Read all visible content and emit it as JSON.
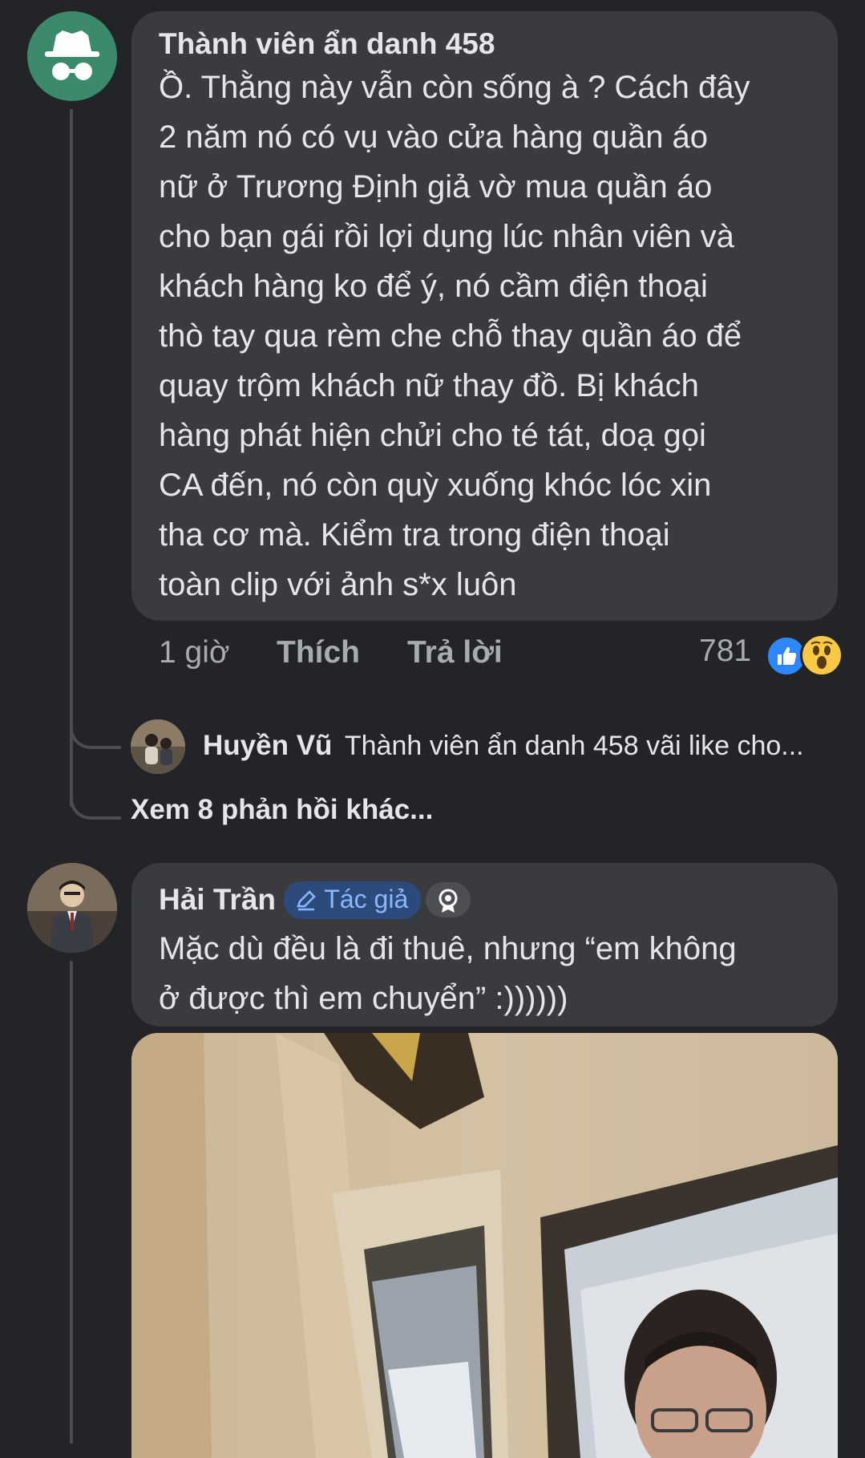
{
  "comment1": {
    "author": "Thành viên ẩn danh 458",
    "lines": [
      "Ồ. Thằng này vẫn còn sống à ? Cách đây",
      "2 năm nó có vụ vào cửa hàng quần áo",
      "nữ ở Trương Định giả vờ mua quần áo",
      "cho bạn gái rồi lợi dụng lúc nhân viên và",
      "khách hàng ko để ý, nó cầm điện thoại",
      "thò tay qua rèm che chỗ thay quần áo để",
      "quay trộm khách nữ thay đồ. Bị khách",
      "hàng phát hiện chửi cho té tát, doạ gọi",
      "CA đến, nó còn quỳ xuống khóc lóc xin",
      "tha cơ mà. Kiểm tra trong điện thoại",
      "toàn clip với ảnh s*x luôn"
    ],
    "time": "1 giờ",
    "like_label": "Thích",
    "reply_label": "Trả lời",
    "reaction_count": "781",
    "reaction_icons": [
      "like-icon",
      "wow-icon"
    ]
  },
  "reply_preview": {
    "author": "Huyền Vũ",
    "text": "Thành viên ẩn danh 458 vãi like cho..."
  },
  "more_replies": "Xem 8 phản hồi khác...",
  "comment2": {
    "author": "Hải Trần",
    "badge_label": "Tác giả",
    "lines": [
      "Mặc dù đều là đi thuê, nhưng “em không",
      "ở được thì em chuyển” :))))))"
    ]
  },
  "colors": {
    "background": "#232427",
    "bubble": "#3a3b3e",
    "anon_avatar": "#3b8a6b",
    "badge_bg": "#2c4a7a",
    "badge_text": "#8ab8ff",
    "like_blue": "#2d88ff"
  }
}
